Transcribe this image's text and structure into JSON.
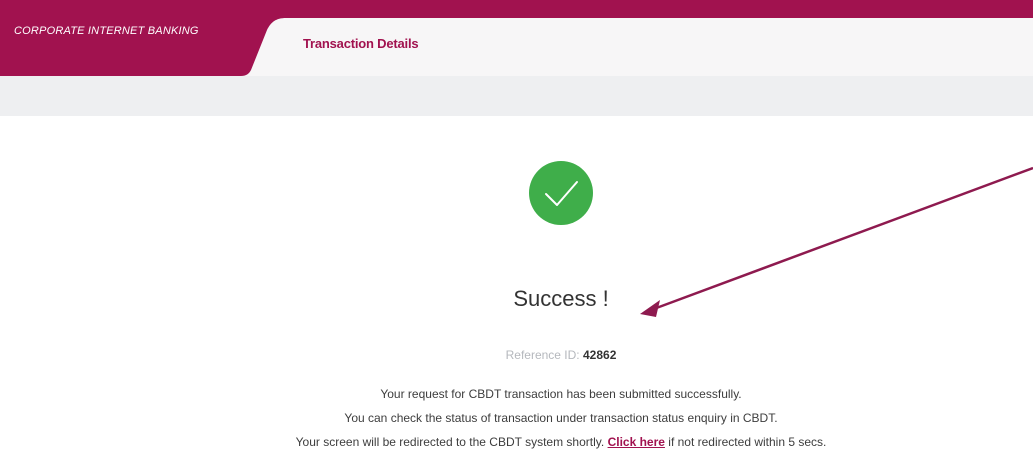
{
  "header": {
    "brand": "CORPORATE INTERNET BANKING",
    "active_tab": "Transaction Details",
    "colors": {
      "brand": "#a1124f",
      "header_bg": "#f7f6f7",
      "subbar_bg": "#eeeff1"
    }
  },
  "main": {
    "status_icon": "check-circle-icon",
    "status_color": "#3fae4a",
    "title": "Success !",
    "reference": {
      "label": "Reference ID:",
      "value": "42862"
    },
    "messages": {
      "line1": "Your request for CBDT transaction has been submitted successfully.",
      "line2": "You can check the status of transaction under transaction status enquiry in CBDT.",
      "line3_before": "Your screen will be redirected to the CBDT system shortly.",
      "link_text": "Click here",
      "line3_after": "if not redirected within 5 secs."
    }
  },
  "annotation": {
    "arrow_color": "#8e1a4f"
  }
}
